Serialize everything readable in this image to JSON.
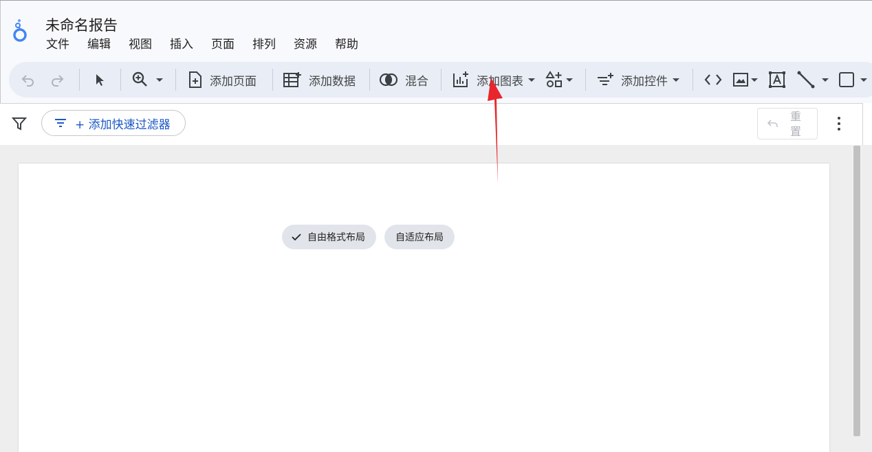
{
  "app": {
    "title": "未命名报告"
  },
  "menu": {
    "items": [
      "文件",
      "编辑",
      "视图",
      "插入",
      "页面",
      "排列",
      "资源",
      "帮助"
    ]
  },
  "toolbar": {
    "undo_icon": "undo-icon",
    "redo_icon": "redo-icon",
    "select_icon": "cursor-icon",
    "zoom_icon": "zoom-in-icon",
    "add_page": "添加页面",
    "add_data": "添加数据",
    "blend": "混合",
    "add_chart": "添加图表",
    "add_control": "添加控件"
  },
  "filterbar": {
    "quick_filter": "+ 添加快速过滤器",
    "reset": "重置"
  },
  "layout_chips": {
    "freeform": "自由格式布局",
    "responsive": "自适应布局",
    "selected": "freeform"
  },
  "colors": {
    "accent_link": "#1a57c5",
    "toolbar_bg": "#e9edf6",
    "annotation_arrow": "#e8262b"
  }
}
